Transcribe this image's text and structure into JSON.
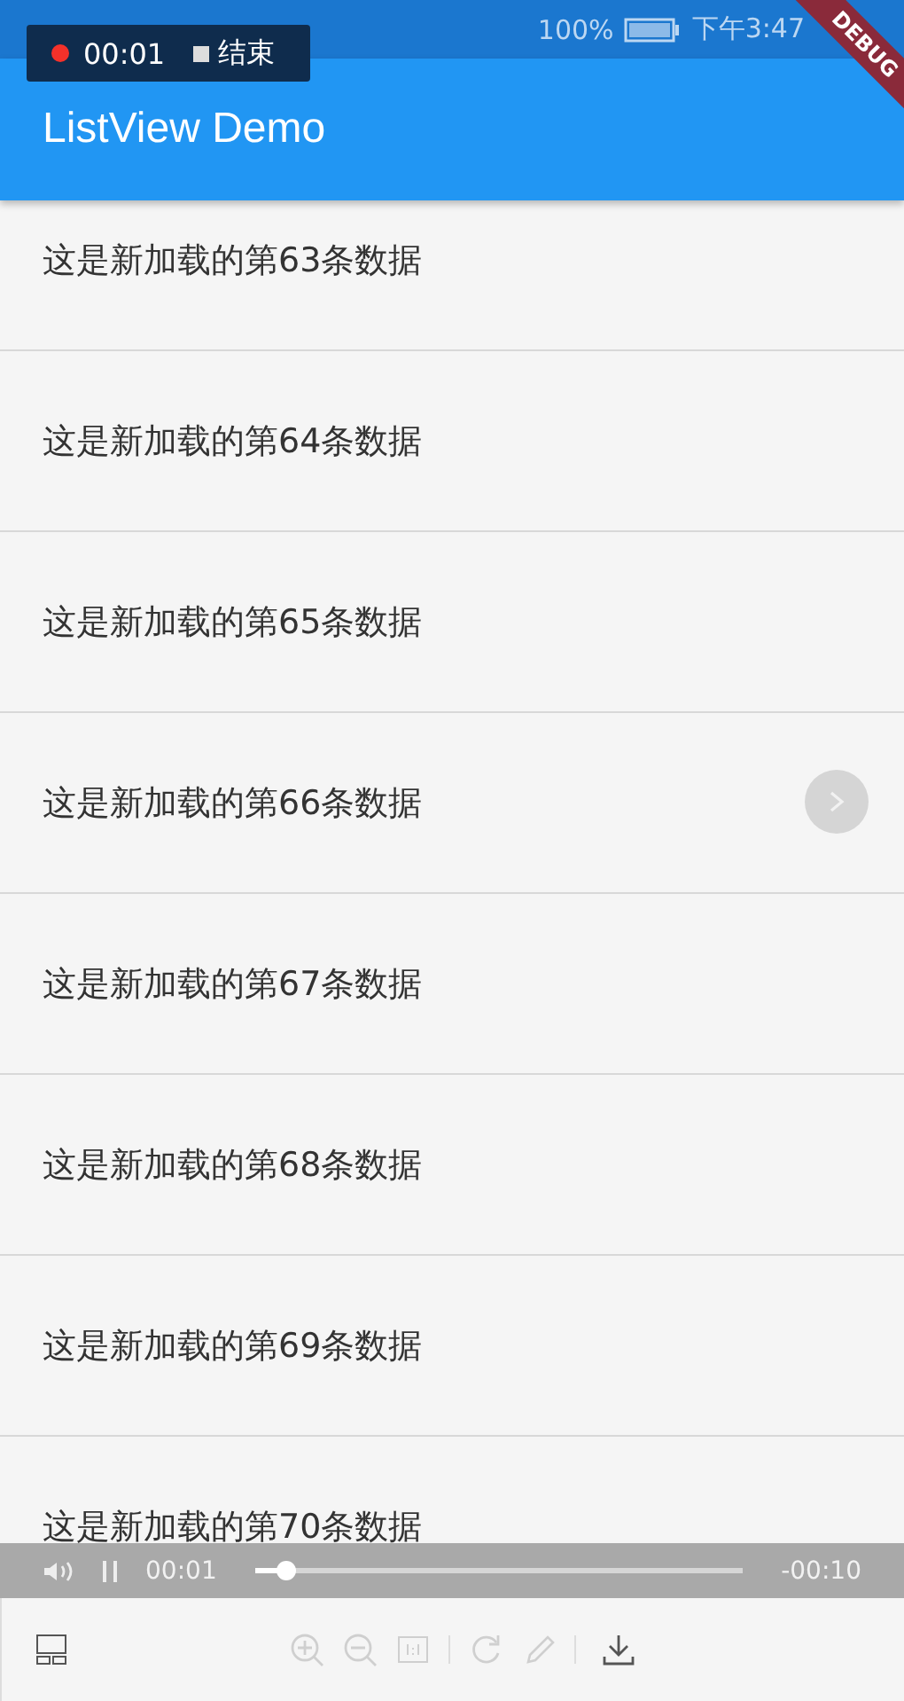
{
  "status_bar": {
    "battery": "100%",
    "time": "下午3:47"
  },
  "recording": {
    "elapsed": "00:01",
    "stop_label": "结束"
  },
  "app_bar": {
    "title": "ListView Demo"
  },
  "debug_banner": "DEBUG",
  "list": {
    "items": [
      {
        "text": "这是新加载的第63条数据"
      },
      {
        "text": "这是新加载的第64条数据"
      },
      {
        "text": "这是新加载的第65条数据"
      },
      {
        "text": "这是新加载的第66条数据"
      },
      {
        "text": "这是新加载的第67条数据"
      },
      {
        "text": "这是新加载的第68条数据"
      },
      {
        "text": "这是新加载的第69条数据"
      },
      {
        "text": "这是新加载的第70条数据"
      }
    ]
  },
  "player": {
    "elapsed": "00:01",
    "remaining": "-00:10",
    "level": 0.06
  },
  "toolbar": {
    "tools": [
      {
        "kind": "layout",
        "disabled": false
      },
      {
        "kind": "zoom-in",
        "disabled": true
      },
      {
        "kind": "zoom-out",
        "disabled": true
      },
      {
        "kind": "actual-size",
        "disabled": true
      },
      {
        "kind": "separator"
      },
      {
        "kind": "rotate",
        "disabled": true
      },
      {
        "kind": "pencil",
        "disabled": true
      },
      {
        "kind": "separator"
      },
      {
        "kind": "download",
        "disabled": false
      }
    ]
  }
}
